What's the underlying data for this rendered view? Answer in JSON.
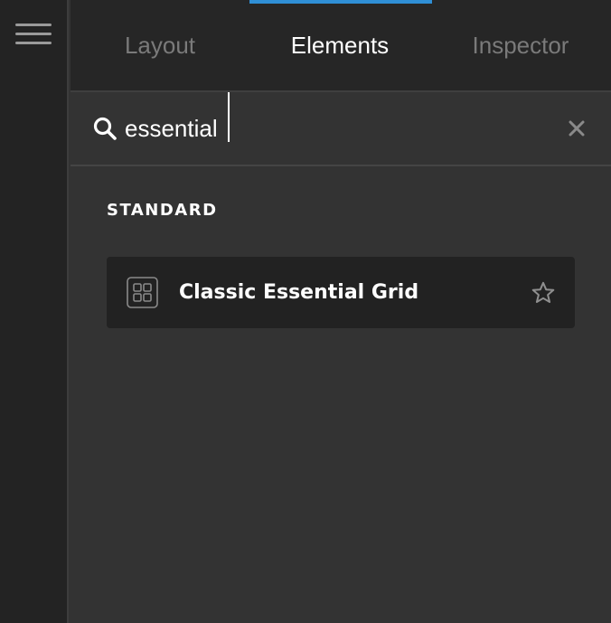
{
  "tabs": [
    {
      "label": "Layout",
      "active": false
    },
    {
      "label": "Elements",
      "active": true
    },
    {
      "label": "Inspector",
      "active": false
    }
  ],
  "search": {
    "value": "essential",
    "placeholder": ""
  },
  "section": {
    "heading": "STANDARD"
  },
  "elements": [
    {
      "label": "Classic Essential Grid",
      "icon": "grid-icon",
      "favorite": false
    }
  ],
  "colors": {
    "accent": "#2f8fd6",
    "background": "#333333",
    "tabbar": "#262626",
    "rail": "#232323",
    "card": "#222222"
  },
  "icons": {
    "menu": "hamburger-menu-icon",
    "search": "search-icon",
    "clear": "close-icon",
    "favorite": "star-icon"
  }
}
